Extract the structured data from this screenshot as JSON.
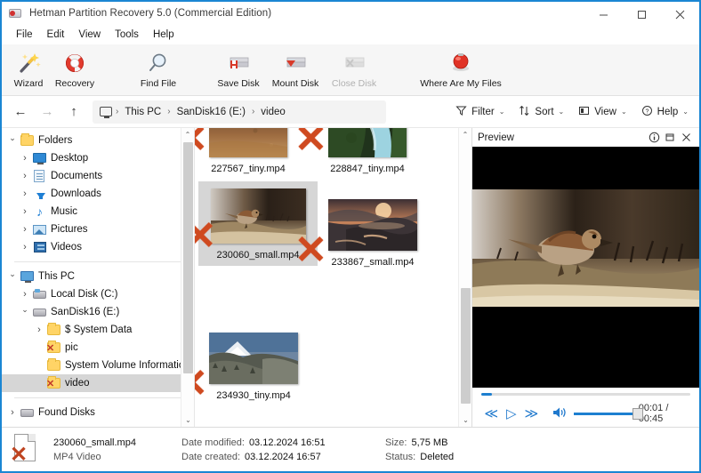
{
  "window": {
    "title": "Hetman Partition Recovery 5.0 (Commercial Edition)",
    "app_icon": "disk-recovery-icon",
    "minimize": "—",
    "maximize": "□",
    "close": "✕",
    "accent": "#1b86d3"
  },
  "menubar": {
    "items": [
      {
        "label": "File"
      },
      {
        "label": "Edit"
      },
      {
        "label": "View"
      },
      {
        "label": "Tools"
      },
      {
        "label": "Help"
      }
    ]
  },
  "toolbar": {
    "buttons": [
      {
        "label": "Wizard",
        "icon": "magic-wand-icon",
        "disabled": false
      },
      {
        "label": "Recovery",
        "icon": "lifebuoy-icon",
        "disabled": false
      },
      {
        "label": "Find File",
        "icon": "magnifier-icon",
        "disabled": false
      },
      {
        "label": "Save Disk",
        "icon": "save-disk-icon",
        "disabled": false
      },
      {
        "label": "Mount Disk",
        "icon": "mount-disk-icon",
        "disabled": false
      },
      {
        "label": "Close Disk",
        "icon": "close-disk-icon",
        "disabled": true
      },
      {
        "label": "Where Are My Files",
        "icon": "red-ball-icon",
        "disabled": false
      }
    ]
  },
  "navbar": {
    "back": "←",
    "forward": "→",
    "up": "↑",
    "breadcrumb": {
      "root_icon": "this-pc-icon",
      "items": [
        "This PC",
        "SanDisk16 (E:)",
        "video"
      ],
      "separator": "›"
    },
    "tools": [
      {
        "label": "Filter",
        "icon": "filter-icon"
      },
      {
        "label": "Sort",
        "icon": "sort-icon"
      },
      {
        "label": "View",
        "icon": "view-icon"
      },
      {
        "label": "Help",
        "icon": "help-icon"
      }
    ],
    "caret": "⌄"
  },
  "sidebar": {
    "groups": [
      {
        "root": {
          "label": "Folders",
          "icon": "folder-icon",
          "expanded": true,
          "indent": 0
        },
        "items": [
          {
            "label": "Desktop",
            "icon": "desktop-icon",
            "expanded": false,
            "indent": 1
          },
          {
            "label": "Documents",
            "icon": "documents-icon",
            "expanded": false,
            "indent": 1
          },
          {
            "label": "Downloads",
            "icon": "downloads-icon",
            "expanded": false,
            "indent": 1
          },
          {
            "label": "Music",
            "icon": "music-icon",
            "expanded": false,
            "indent": 1
          },
          {
            "label": "Pictures",
            "icon": "pictures-icon",
            "expanded": false,
            "indent": 1
          },
          {
            "label": "Videos",
            "icon": "videos-icon",
            "expanded": false,
            "indent": 1
          }
        ]
      },
      {
        "root": {
          "label": "This PC",
          "icon": "this-pc-icon",
          "expanded": true,
          "indent": 0
        },
        "items": [
          {
            "label": "Local Disk (C:)",
            "icon": "system-drive-icon",
            "expanded": false,
            "indent": 1
          },
          {
            "label": "SanDisk16 (E:)",
            "icon": "drive-icon",
            "expanded": true,
            "indent": 1
          },
          {
            "label": "$ System Data",
            "icon": "folder-icon",
            "expanded": false,
            "indent": 2
          },
          {
            "label": "pic",
            "icon": "deleted-folder-icon",
            "expanded": null,
            "indent": 2
          },
          {
            "label": "System Volume Information",
            "icon": "folder-icon",
            "expanded": null,
            "indent": 2
          },
          {
            "label": "video",
            "icon": "deleted-folder-icon",
            "expanded": null,
            "indent": 2,
            "selected": true
          }
        ]
      },
      {
        "root": {
          "label": "Found Disks",
          "icon": "drive-icon",
          "expanded": false,
          "indent": 0
        },
        "items": []
      }
    ],
    "scrollbar": {
      "up": "⌃",
      "down": "⌄"
    }
  },
  "files": {
    "items": [
      {
        "name": "227567_tiny.mp4",
        "selected": false,
        "deleted": true,
        "thumb": "dirt-ground"
      },
      {
        "name": "228847_tiny.mp4",
        "selected": false,
        "deleted": true,
        "thumb": "forest-river"
      },
      {
        "name": "230060_small.mp4",
        "selected": true,
        "deleted": true,
        "thumb": "sparrow-wall"
      },
      {
        "name": "233867_small.mp4",
        "selected": false,
        "deleted": true,
        "thumb": "sunset-sea"
      },
      {
        "name": "234930_tiny.mp4",
        "selected": false,
        "deleted": true,
        "thumb": "snow-mountain"
      }
    ],
    "deleted_mark": "✕",
    "scrollbar": {
      "up": "⌃",
      "down": "⌄"
    }
  },
  "preview": {
    "title": "Preview",
    "icons": [
      {
        "name": "info-icon",
        "glyph": "ⓘ"
      },
      {
        "name": "undock-icon",
        "glyph": "⧉"
      },
      {
        "name": "close-icon",
        "glyph": "✕"
      }
    ],
    "player": {
      "rewind": "≪",
      "play": "▷",
      "forward": "≫",
      "volume_icon": "ᵈ)))",
      "time": "00:01 / 00:45",
      "progress_percent": 2,
      "volume_percent": 100
    }
  },
  "statusbar": {
    "filename": "230060_small.mp4",
    "filetype": "MP4 Video",
    "date_modified_label": "Date modified:",
    "date_modified": "03.12.2024 16:51",
    "date_created_label": "Date created:",
    "date_created": "03.12.2024 16:57",
    "size_label": "Size:",
    "size": "5,75 MB",
    "status_label": "Status:",
    "status": "Deleted"
  }
}
